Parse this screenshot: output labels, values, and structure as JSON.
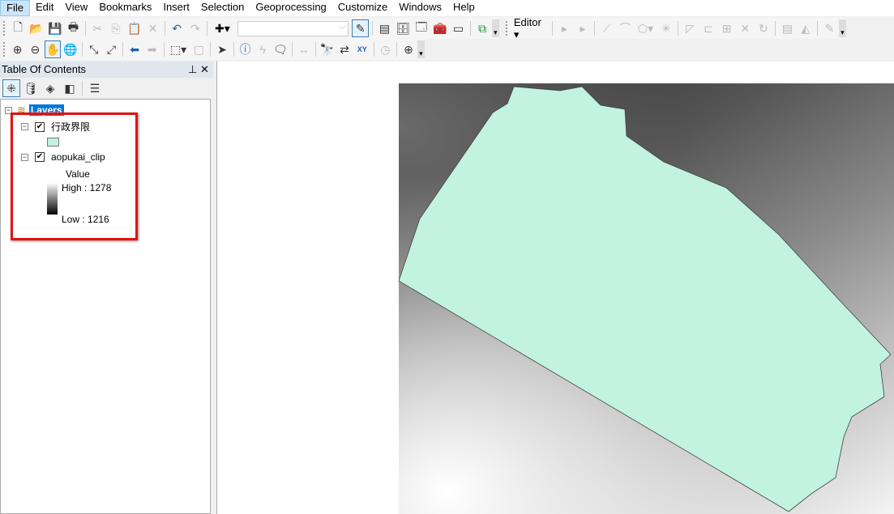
{
  "menubar": {
    "items": [
      "File",
      "Edit",
      "View",
      "Bookmarks",
      "Insert",
      "Selection",
      "Geoprocessing",
      "Customize",
      "Windows",
      "Help"
    ],
    "active": "File"
  },
  "toolbar": {
    "editor_label": "Editor",
    "scale_value": ""
  },
  "toc": {
    "title": "Table Of Contents",
    "pin_icon": "pin-icon",
    "close_icon": "close-icon",
    "data_frame": "Layers",
    "layers": [
      {
        "name": "行政界限",
        "checked": true,
        "symbol_color": "#c2f2e0"
      },
      {
        "name": "aopukai_clip",
        "checked": true,
        "field": "Value",
        "high": "High : 1278",
        "low": "Low : 1216"
      }
    ]
  },
  "colors": {
    "polygon_fill": "#c2f2e0",
    "highlight_box": "#e81010",
    "selection": "#0078d7"
  }
}
